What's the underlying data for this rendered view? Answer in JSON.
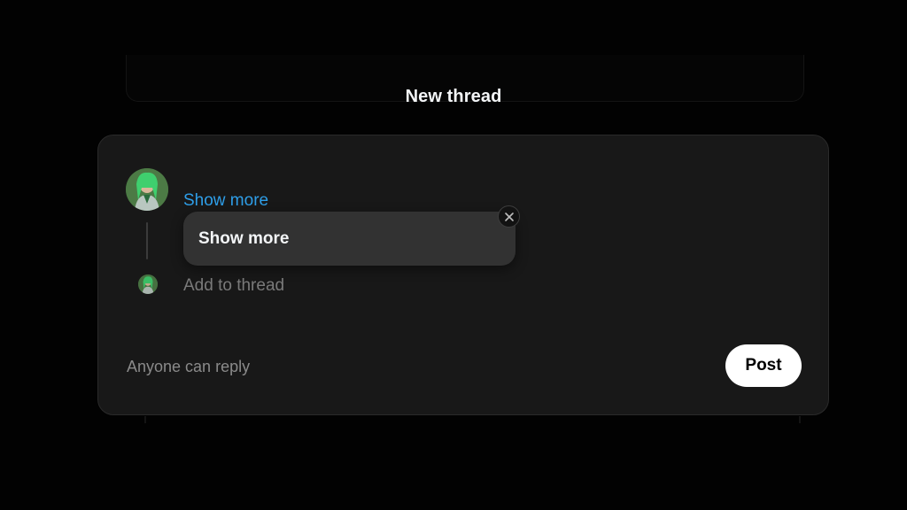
{
  "modal": {
    "title": "New thread"
  },
  "composer": {
    "avatar_icon": "user-avatar",
    "show_more_link": "Show more",
    "tooltip": {
      "text": "Show more",
      "close_icon": "close-icon"
    },
    "add_to_thread_placeholder": "Add to thread",
    "reply_setting": "Anyone can reply",
    "post_label": "Post"
  },
  "colors": {
    "background": "#000000",
    "card": "#181818",
    "link": "#2e9ee8",
    "post_button": "#ffffff"
  }
}
